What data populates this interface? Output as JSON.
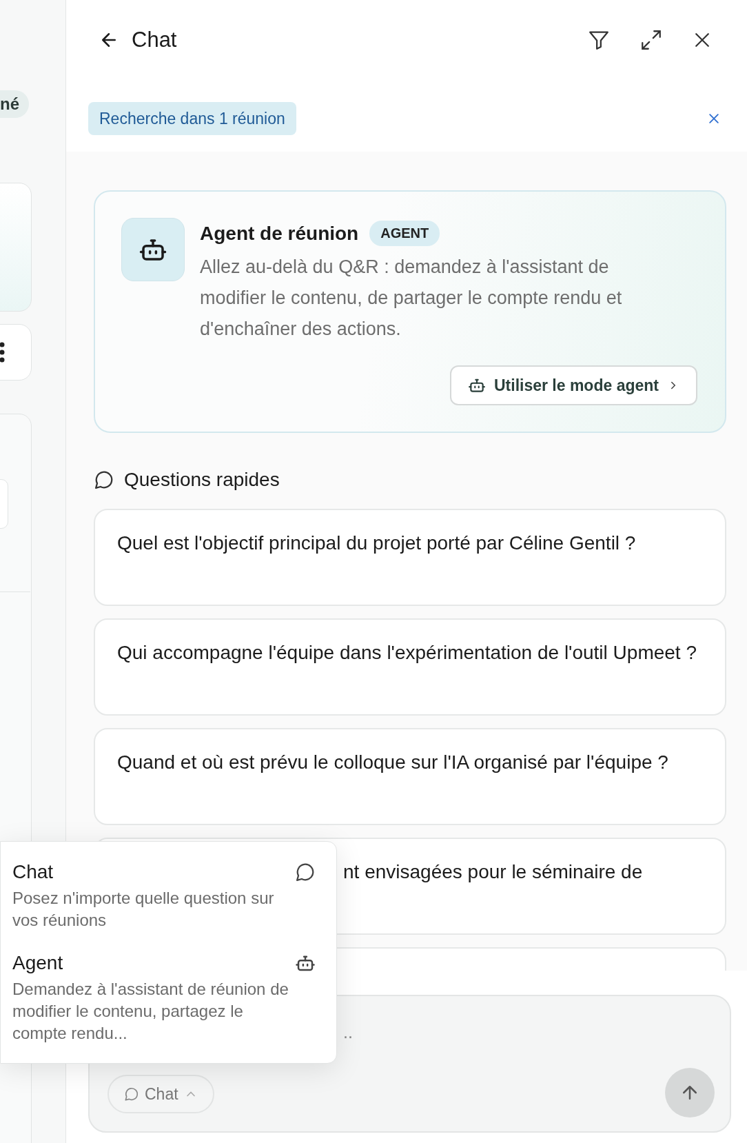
{
  "sidebar_peek": {
    "chip": "né"
  },
  "header": {
    "title": "Chat"
  },
  "scope_chip": {
    "label": "Recherche dans 1 réunion"
  },
  "agent_card": {
    "title": "Agent de réunion",
    "badge": "AGENT",
    "description": "Allez au-delà du Q&R : demandez à l'assistant de modifier le contenu, de partager le compte rendu et d'enchaîner des actions.",
    "button": "Utiliser le mode agent"
  },
  "quick_questions": {
    "title": "Questions rapides",
    "items": [
      {
        "kind": "full",
        "text": "Quel est l'objectif principal du projet porté par Céline Gentil ?"
      },
      {
        "kind": "full",
        "text": "Qui accompagne l'équipe dans l'expérimentation de l'outil Upmeet ?"
      },
      {
        "kind": "full",
        "text": "Quand et où est prévu le colloque sur l'IA organisé par l'équipe ?"
      },
      {
        "kind": "covered",
        "text": "nt envisagées pour le séminaire de"
      }
    ]
  },
  "mode_menu": {
    "items": [
      {
        "kind": "chat",
        "label": "Chat",
        "description": "Posez n'importe quelle question sur vos réunions"
      },
      {
        "kind": "agent",
        "label": "Agent",
        "description": "Demandez à l'assistant de réunion de modifier le contenu, partagez le compte rendu..."
      }
    ]
  },
  "composer": {
    "placeholder": "..",
    "mode_button": "Chat"
  }
}
